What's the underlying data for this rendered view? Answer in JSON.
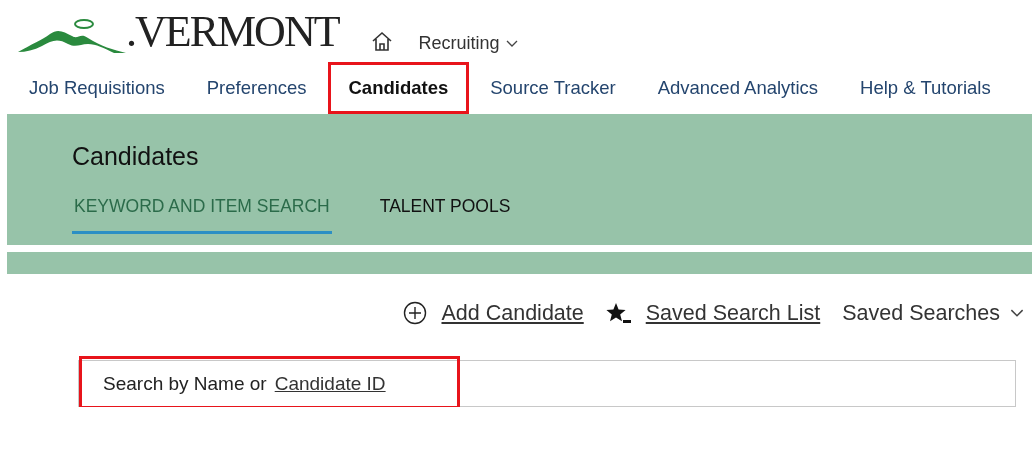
{
  "header": {
    "logo_text": ".VERMONT",
    "module": "Recruiting"
  },
  "nav": [
    {
      "label": "Job Requisitions",
      "selected": false,
      "highlighted": false
    },
    {
      "label": "Preferences",
      "selected": false,
      "highlighted": false
    },
    {
      "label": "Candidates",
      "selected": true,
      "highlighted": true
    },
    {
      "label": "Source Tracker",
      "selected": false,
      "highlighted": false
    },
    {
      "label": "Advanced Analytics",
      "selected": false,
      "highlighted": false
    },
    {
      "label": "Help & Tutorials",
      "selected": false,
      "highlighted": false
    }
  ],
  "panel": {
    "title": "Candidates",
    "tabs": [
      {
        "label": "KEYWORD AND ITEM SEARCH",
        "selected": true
      },
      {
        "label": "TALENT POOLS",
        "selected": false
      }
    ]
  },
  "actions": [
    {
      "kind": "add",
      "label": "Add Candidate"
    },
    {
      "kind": "saved-list",
      "label": "Saved Search List"
    },
    {
      "kind": "dropdown",
      "label": "Saved Searches"
    }
  ],
  "search": {
    "label": "Search by Name or",
    "link": "Candidate ID",
    "highlighted": true
  }
}
